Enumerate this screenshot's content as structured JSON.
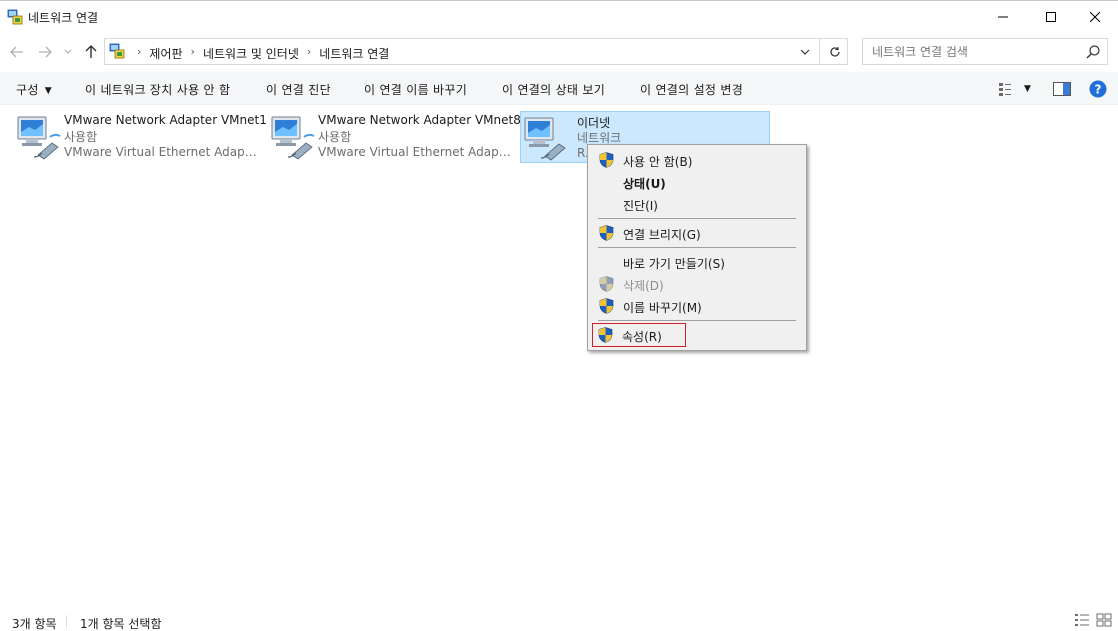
{
  "window": {
    "title": "네트워크 연결"
  },
  "breadcrumb": [
    "제어판",
    "네트워크 및 인터넷",
    "네트워크 연결"
  ],
  "search": {
    "placeholder": "네트워크 연결 검색"
  },
  "commands": {
    "organize": "구성",
    "disable": "이 네트워크 장치 사용 안 함",
    "diagnose": "이 연결 진단",
    "rename": "이 연결 이름 바꾸기",
    "status": "이 연결의 상태 보기",
    "settings": "이 연결의 설정 변경"
  },
  "items": [
    {
      "name": "VMware Network Adapter VMnet1",
      "status": "사용함",
      "device": "VMware Virtual Ethernet Adapter ..."
    },
    {
      "name": "VMware Network Adapter VMnet8",
      "status": "사용함",
      "device": "VMware Virtual Ethernet Adapter ..."
    },
    {
      "name": "이더넷",
      "status": "네트워크",
      "device": "Re"
    }
  ],
  "context_menu": [
    {
      "label": "사용 안 함(B)",
      "shield": true,
      "bold": false,
      "disabled": false
    },
    {
      "label": "상태(U)",
      "shield": false,
      "bold": true,
      "disabled": false
    },
    {
      "label": "진단(I)",
      "shield": false,
      "bold": false,
      "disabled": false
    },
    {
      "label": "연결 브리지(G)",
      "shield": true,
      "bold": false,
      "disabled": false
    },
    {
      "label": "바로 가기 만들기(S)",
      "shield": false,
      "bold": false,
      "disabled": false
    },
    {
      "label": "삭제(D)",
      "shield": true,
      "bold": false,
      "disabled": true
    },
    {
      "label": "이름 바꾸기(M)",
      "shield": true,
      "bold": false,
      "disabled": false
    },
    {
      "label": "속성(R)",
      "shield": true,
      "bold": false,
      "disabled": false,
      "highlighted": true
    }
  ],
  "statusbar": {
    "count": "3개 항목",
    "selected": "1개 항목 선택함"
  },
  "colors": {
    "selection_bg": "#cce8ff",
    "selection_border": "#99d1ff",
    "highlight_box": "#d0202a",
    "help_blue": "#1e6fd9"
  }
}
